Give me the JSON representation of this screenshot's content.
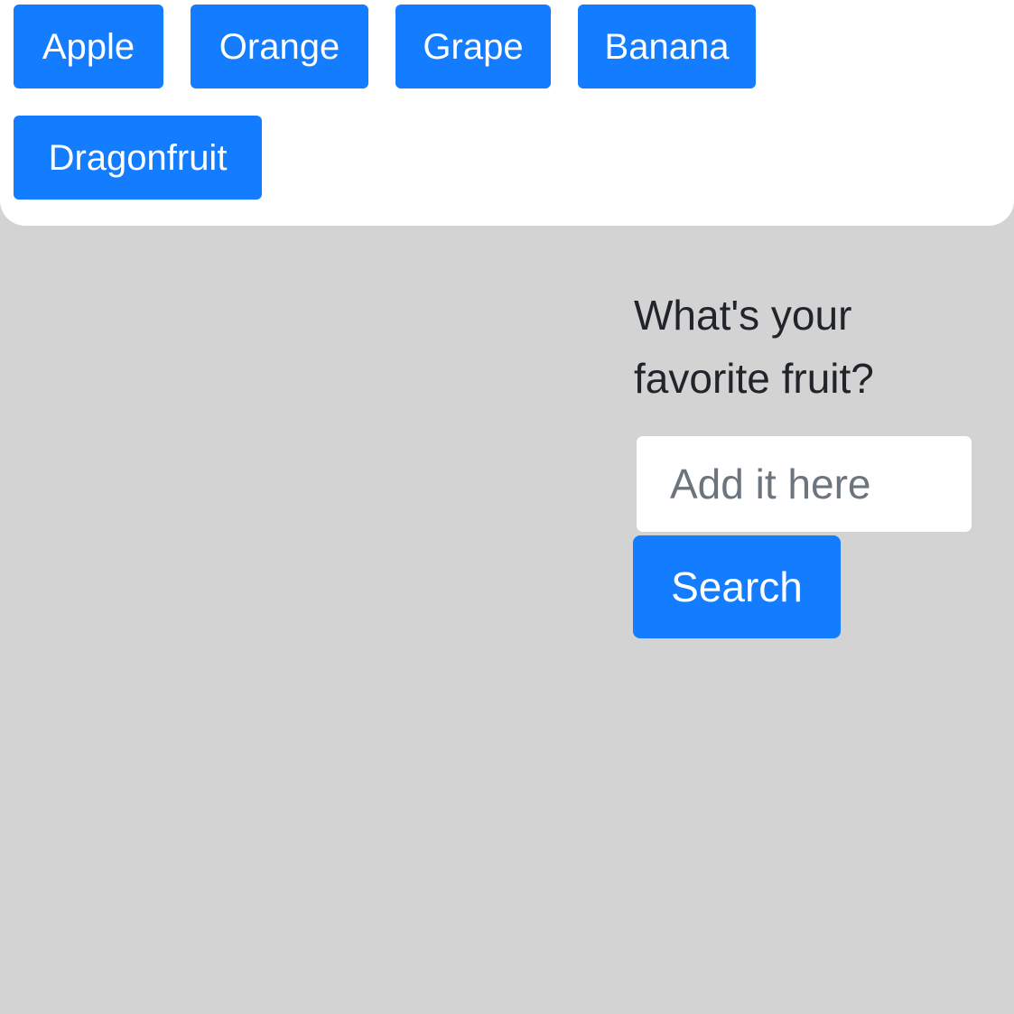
{
  "fruit_buttons": [
    {
      "label": "Apple"
    },
    {
      "label": "Orange"
    },
    {
      "label": "Grape"
    },
    {
      "label": "Banana"
    },
    {
      "label": "Dragonfruit"
    }
  ],
  "form": {
    "question": "What's your favorite fruit?",
    "input_value": "",
    "input_placeholder": "Add it here",
    "search_label": "Search"
  },
  "colors": {
    "primary": "#137cff",
    "background": "#d3d3d4",
    "panel": "#ffffff",
    "text": "#212529",
    "placeholder": "#6c757d"
  }
}
